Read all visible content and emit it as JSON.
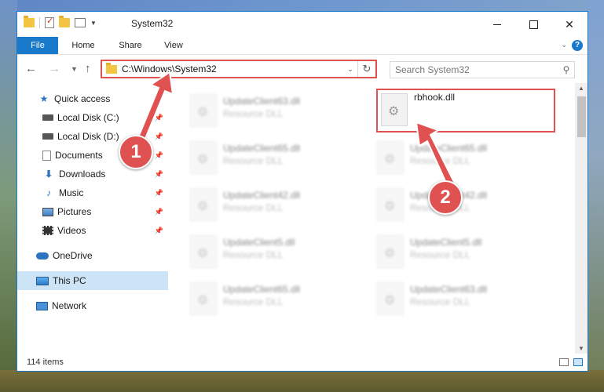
{
  "window": {
    "title": "System32",
    "controls": {
      "minimize": "minimize",
      "maximize": "maximize",
      "close": "✕"
    }
  },
  "ribbon": {
    "tabs": [
      "File",
      "Home",
      "Share",
      "View"
    ],
    "help": "?"
  },
  "navigation": {
    "address_path": "C:\\Windows\\System32",
    "search_placeholder": "Search System32"
  },
  "sidebar": {
    "items": [
      {
        "label": "Quick access",
        "icon": "star-icon",
        "pinned": false
      },
      {
        "label": "Local Disk (C:)",
        "icon": "disk-icon",
        "pinned": true
      },
      {
        "label": "Local Disk (D:)",
        "icon": "disk-icon",
        "pinned": true
      },
      {
        "label": "Documents",
        "icon": "documents-icon",
        "pinned": true
      },
      {
        "label": "Downloads",
        "icon": "downloads-icon",
        "pinned": true
      },
      {
        "label": "Music",
        "icon": "music-icon",
        "pinned": true
      },
      {
        "label": "Pictures",
        "icon": "pictures-icon",
        "pinned": true
      },
      {
        "label": "Videos",
        "icon": "videos-icon",
        "pinned": true
      },
      {
        "label": "OneDrive",
        "icon": "onedrive-icon",
        "pinned": false
      },
      {
        "label": "This PC",
        "icon": "this-pc-icon",
        "pinned": false,
        "selected": true
      },
      {
        "label": "Network",
        "icon": "network-icon",
        "pinned": false
      }
    ]
  },
  "files": [
    {
      "name": "UpdateClient63.dll",
      "type": "Resource DLL",
      "blurred": true
    },
    {
      "name": "rbhook.dll",
      "type": "",
      "blurred": false,
      "highlighted": true
    },
    {
      "name": "UpdateClient65.dll",
      "type": "Resource DLL",
      "blurred": true
    },
    {
      "name": "UpdateClient65.dll",
      "type": "Resource DLL",
      "blurred": true
    },
    {
      "name": "UpdateClient42.dll",
      "type": "Resource DLL",
      "blurred": true
    },
    {
      "name": "UpdateClient42.dll",
      "type": "Resource DLL",
      "blurred": true
    },
    {
      "name": "UpdateClient5.dll",
      "type": "Resource DLL",
      "blurred": true
    },
    {
      "name": "UpdateClient5.dll",
      "type": "Resource DLL",
      "blurred": true
    },
    {
      "name": "UpdateClient65.dll",
      "type": "Resource DLL",
      "blurred": true
    },
    {
      "name": "UpdateClient63.dll",
      "type": "Resource DLL",
      "blurred": true
    }
  ],
  "status": {
    "item_count": "114 items"
  },
  "annotations": {
    "callout_1": "1",
    "callout_2": "2",
    "accent_color": "#e05252"
  }
}
